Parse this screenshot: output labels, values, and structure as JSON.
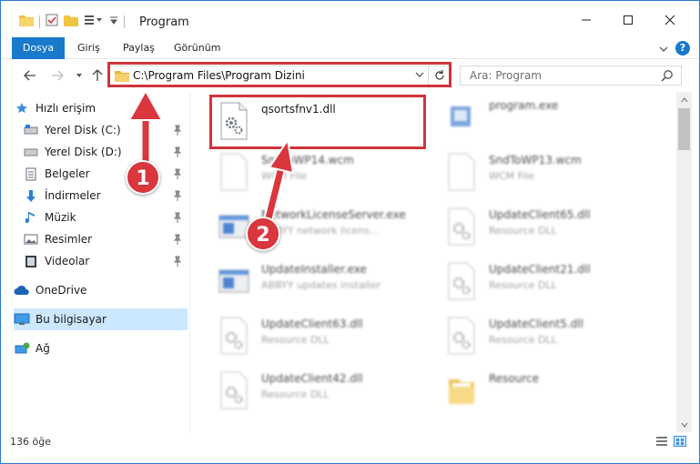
{
  "window": {
    "title": "Program"
  },
  "ribbon": {
    "tabs": [
      "Dosya",
      "Giriş",
      "Paylaş",
      "Görünüm"
    ],
    "help": "?"
  },
  "address": {
    "path": "C:\\Program Files\\Program Dizini"
  },
  "search": {
    "placeholder": "Ara: Program"
  },
  "sidebar": {
    "items": [
      {
        "label": "Hızlı erişim",
        "icon": "star-icon",
        "pinned": false
      },
      {
        "label": "Yerel Disk (C:)",
        "icon": "drive-icon",
        "pinned": true
      },
      {
        "label": "Yerel Disk (D:)",
        "icon": "drive-icon",
        "pinned": true
      },
      {
        "label": "Belgeler",
        "icon": "documents-icon",
        "pinned": true
      },
      {
        "label": "İndirmeler",
        "icon": "download-icon",
        "pinned": true
      },
      {
        "label": "Müzik",
        "icon": "music-icon",
        "pinned": true
      },
      {
        "label": "Resimler",
        "icon": "pictures-icon",
        "pinned": true
      },
      {
        "label": "Videolar",
        "icon": "videos-icon",
        "pinned": true
      },
      {
        "label": "OneDrive",
        "icon": "cloud-icon",
        "pinned": false
      },
      {
        "label": "Bu bilgisayar",
        "icon": "computer-icon",
        "pinned": false,
        "selected": true
      },
      {
        "label": "Ağ",
        "icon": "network-icon",
        "pinned": false
      }
    ]
  },
  "files": [
    {
      "name": "qsortsfnv1.dll",
      "desc": "",
      "icon": "dll-gear-icon",
      "highlighted": true
    },
    {
      "name": "program.exe",
      "desc": "",
      "icon": "exe-icon"
    },
    {
      "name": "SndToWP14.wcm",
      "desc": "WCM File",
      "icon": "blank-file-icon"
    },
    {
      "name": "SndToWP13.wcm",
      "desc": "WCM File",
      "icon": "blank-file-icon"
    },
    {
      "name": "NetworkLicenseServer.exe",
      "desc": "ABBYY network licens...",
      "icon": "exe-window-icon"
    },
    {
      "name": "UpdateClient65.dll",
      "desc": "Resource DLL",
      "icon": "dll-gear-icon"
    },
    {
      "name": "UpdateInstaller.exe",
      "desc": "ABBYY updates installer",
      "icon": "exe-window-icon"
    },
    {
      "name": "UpdateClient21.dll",
      "desc": "Resource DLL",
      "icon": "dll-gear-icon"
    },
    {
      "name": "UpdateClient63.dll",
      "desc": "Resource DLL",
      "icon": "dll-gear-icon"
    },
    {
      "name": "UpdateClient5.dll",
      "desc": "Resource DLL",
      "icon": "dll-gear-icon"
    },
    {
      "name": "UpdateClient42.dll",
      "desc": "Resource DLL",
      "icon": "dll-gear-icon"
    },
    {
      "name": "Resource",
      "desc": "",
      "icon": "folder-icon"
    }
  ],
  "status": {
    "count": "136 öğe"
  },
  "callouts": {
    "one": "1",
    "two": "2"
  },
  "colors": {
    "accent": "#1979ca",
    "highlight": "#d0343a",
    "badge": "#d9363e",
    "selected": "#cce8ff"
  }
}
